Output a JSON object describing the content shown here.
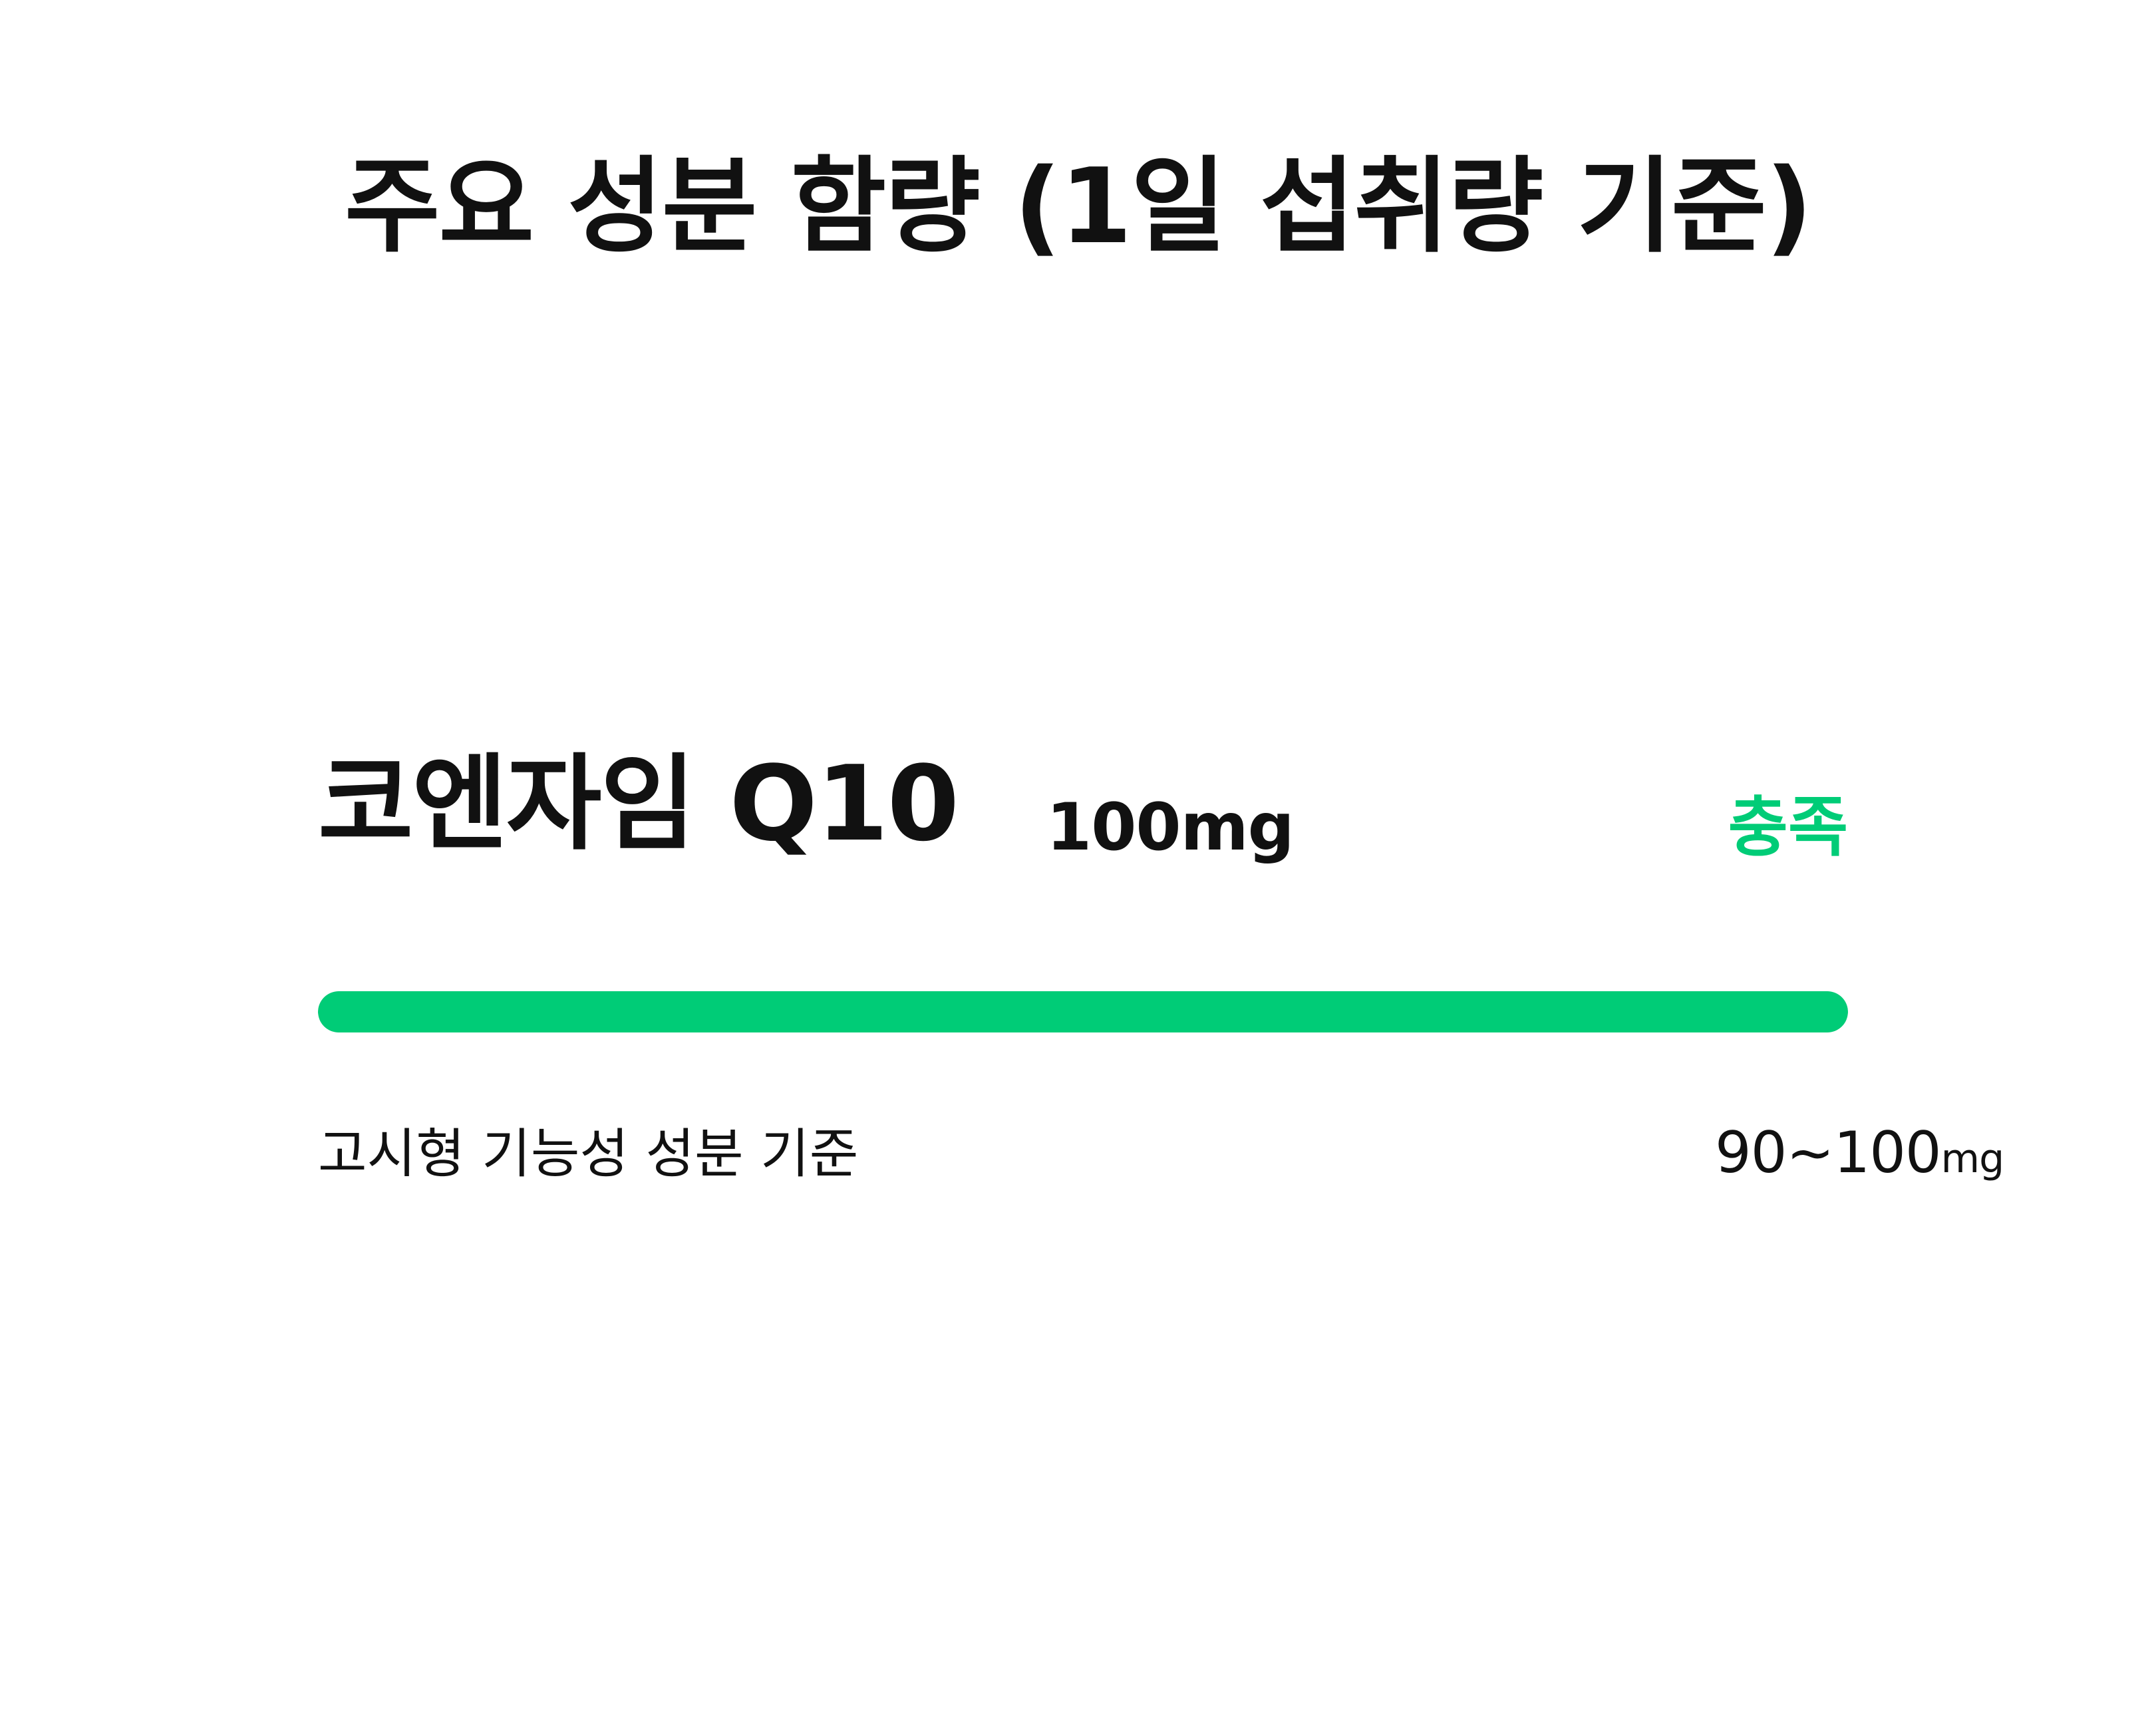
{
  "title": "주요 성분 함량 (1일 섭취량 기준)",
  "ingredient": {
    "name": "코엔자임 Q10",
    "amount": "100mg",
    "status": "충족",
    "fill_fraction": 1.0,
    "standard_label": "고시형 기능성 성분 기준",
    "standard_range": "90~100",
    "standard_unit": "mg"
  },
  "colors": {
    "accent": "#00CC77",
    "text": "#111111",
    "background": "#FFFFFF"
  }
}
